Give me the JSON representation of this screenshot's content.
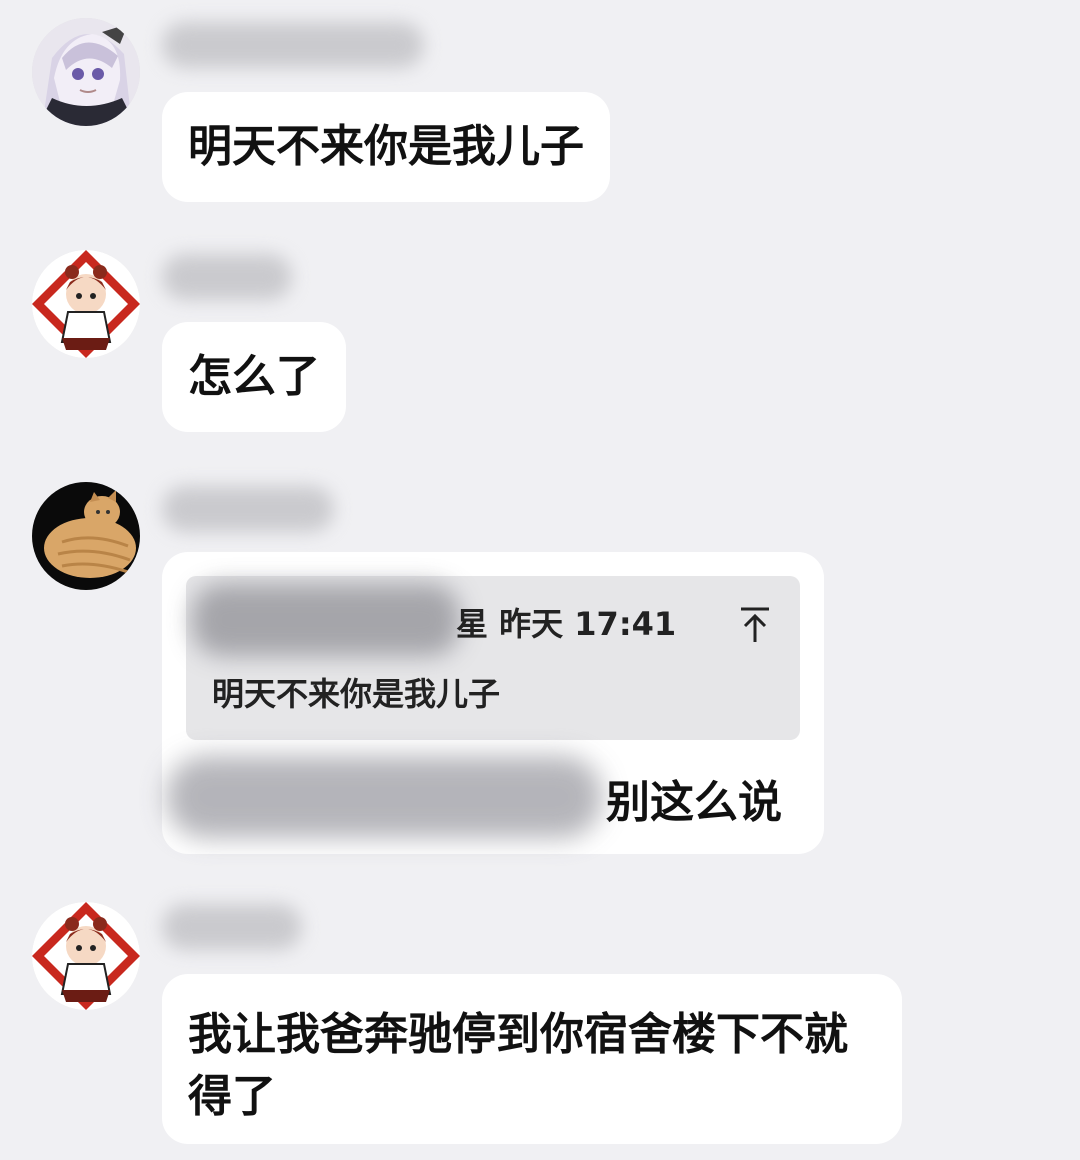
{
  "messages": [
    {
      "avatar": "anime-silver-hair-avatar",
      "text": "明天不来你是我儿子"
    },
    {
      "avatar": "cartoon-girl-sticker-avatar",
      "text": "怎么了"
    },
    {
      "avatar": "orange-cat-avatar",
      "quote": {
        "meta": "星 昨天 17:41",
        "text": "明天不来你是我儿子",
        "icon": "jump-to-original-icon"
      },
      "text": "别这么说"
    },
    {
      "avatar": "cartoon-girl-sticker-avatar",
      "text": "我让我爸奔驰停到你宿舍楼下不就得了"
    }
  ],
  "colors": {
    "background": "#f0f0f3",
    "bubble": "#ffffff",
    "quote_background": "#e6e6e8",
    "text": "#111111"
  }
}
